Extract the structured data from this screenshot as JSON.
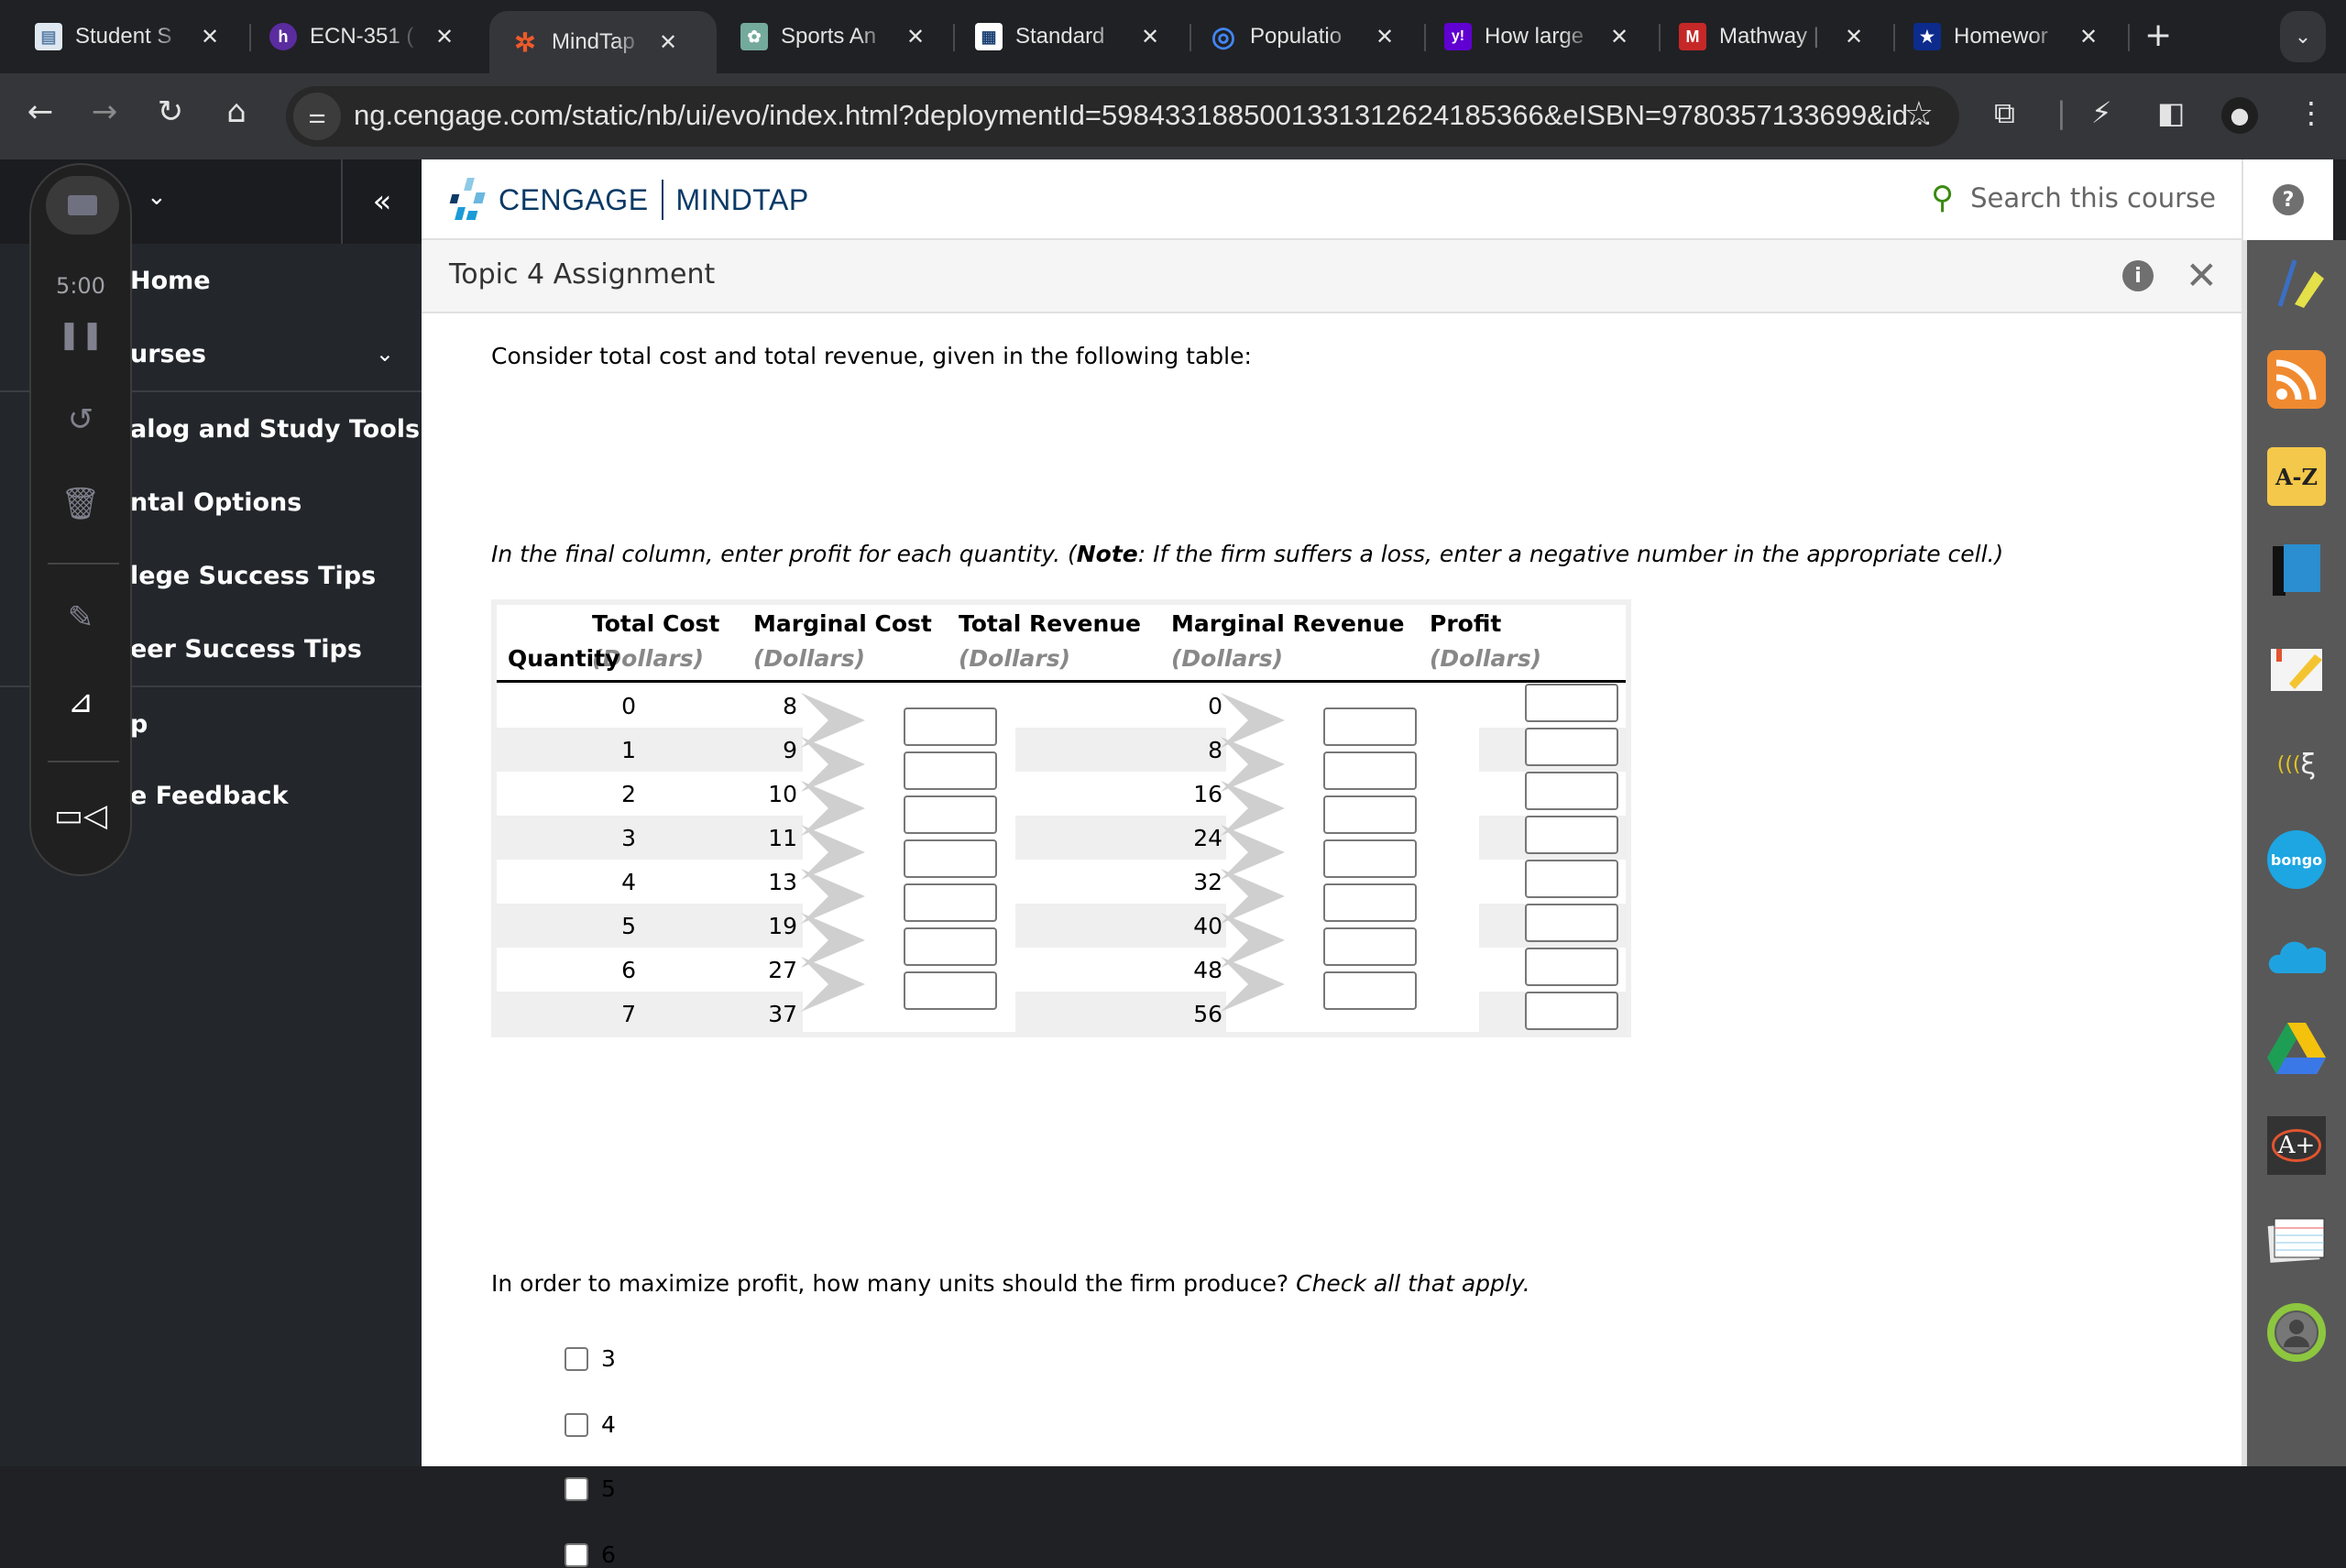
{
  "browser": {
    "tabs": [
      {
        "title": "Student S",
        "icon": "document-icon",
        "color": "#8ab4f8",
        "glyph": "▤"
      },
      {
        "title": "ECN-351 (",
        "icon": "hypothesis-icon",
        "color": "#5a2ca0",
        "glyph": "h"
      },
      {
        "title": "MindTap -",
        "icon": "mindtap-icon",
        "color": "#35363a",
        "glyph": "✲",
        "active": true
      },
      {
        "title": "Sports An",
        "icon": "chatgpt-icon",
        "color": "#74aa9c",
        "glyph": "⚙"
      },
      {
        "title": "Standard",
        "icon": "calculator-icon",
        "color": "#ffffff",
        "glyph": "▦"
      },
      {
        "title": "Populatio",
        "icon": "globe-icon",
        "color": "#4285f4",
        "glyph": "◎"
      },
      {
        "title": "How large",
        "icon": "yahoo-icon",
        "color": "#6001d2",
        "glyph": "y!"
      },
      {
        "title": "Mathway |",
        "icon": "mathway-icon",
        "color": "#c62828",
        "glyph": "M"
      },
      {
        "title": "Homewor",
        "icon": "star-badge-icon",
        "color": "#0d2b8c",
        "glyph": "★"
      }
    ],
    "new_tab": "+",
    "tab_menu": "⌄",
    "url": "ng.cengage.com/static/nb/ui/evo/index.html?deploymentId=5984331885001331312624185366&eISBN=9780357133699&id..."
  },
  "sidebar": {
    "items": [
      {
        "label": "Home"
      },
      {
        "label": "urses",
        "has_caret": true
      },
      {
        "label": "alog and Study Tools"
      },
      {
        "label": "ntal Options"
      },
      {
        "label": "lege Success Tips"
      },
      {
        "label": "eer Success Tips"
      },
      {
        "label": "p"
      },
      {
        "label": "e Feedback"
      }
    ],
    "collapse_glyph": "«"
  },
  "recorder": {
    "time": "5:00"
  },
  "header": {
    "brand": "CENGAGE",
    "product": "MINDTAP",
    "search_placeholder": "Search this course",
    "help_glyph": "?"
  },
  "assignment": {
    "title": "Topic 4 Assignment",
    "info_glyph": "i",
    "close_glyph": "✕"
  },
  "question": {
    "intro": "Consider total cost and total revenue, given in the following table:",
    "instruction_pre": "In the final column, enter profit for each quantity. (",
    "instruction_bold": "Note",
    "instruction_post": ": If the firm suffers a loss, enter a negative number in the appropriate cell.)",
    "table": {
      "headers": [
        {
          "title": "",
          "sub": "Quantity"
        },
        {
          "title": "Total Cost",
          "sub": "(Dollars)"
        },
        {
          "title": "Marginal Cost",
          "sub": "(Dollars)"
        },
        {
          "title": "Total Revenue",
          "sub": "(Dollars)"
        },
        {
          "title": "Marginal Revenue",
          "sub": "(Dollars)"
        },
        {
          "title": "Profit",
          "sub": "(Dollars)"
        }
      ],
      "rows": [
        {
          "quantity": "0",
          "total_cost": "8",
          "total_revenue": "0",
          "profit": ""
        },
        {
          "quantity": "1",
          "total_cost": "9",
          "total_revenue": "8",
          "profit": ""
        },
        {
          "quantity": "2",
          "total_cost": "10",
          "total_revenue": "16",
          "profit": ""
        },
        {
          "quantity": "3",
          "total_cost": "11",
          "total_revenue": "24",
          "profit": ""
        },
        {
          "quantity": "4",
          "total_cost": "13",
          "total_revenue": "32",
          "profit": ""
        },
        {
          "quantity": "5",
          "total_cost": "19",
          "total_revenue": "40",
          "profit": ""
        },
        {
          "quantity": "6",
          "total_cost": "27",
          "total_revenue": "48",
          "profit": ""
        },
        {
          "quantity": "7",
          "total_cost": "37",
          "total_revenue": "56",
          "profit": ""
        }
      ],
      "marginal_cost": [
        "",
        "",
        "",
        "",
        "",
        "",
        ""
      ],
      "marginal_revenue": [
        "",
        "",
        "",
        "",
        "",
        "",
        ""
      ]
    },
    "q2_pre": "In order to maximize profit, how many units should the firm produce? ",
    "q2_italic": "Check all that apply.",
    "options": [
      {
        "label": "3",
        "checked": false
      },
      {
        "label": "4",
        "checked": false
      },
      {
        "label": "5",
        "checked": false
      },
      {
        "label": "6",
        "checked": false
      }
    ]
  },
  "tools_rail": [
    {
      "name": "highlighter-pen-icon"
    },
    {
      "name": "rss-feed-icon"
    },
    {
      "name": "glossary-az-icon"
    },
    {
      "name": "ebook-icon"
    },
    {
      "name": "notes-highlight-icon"
    },
    {
      "name": "readspeaker-icon"
    },
    {
      "name": "bongo-icon"
    },
    {
      "name": "onedrive-icon"
    },
    {
      "name": "google-drive-icon"
    },
    {
      "name": "aplus-grade-icon"
    },
    {
      "name": "flashcards-icon"
    },
    {
      "name": "progress-avatar-icon"
    }
  ]
}
